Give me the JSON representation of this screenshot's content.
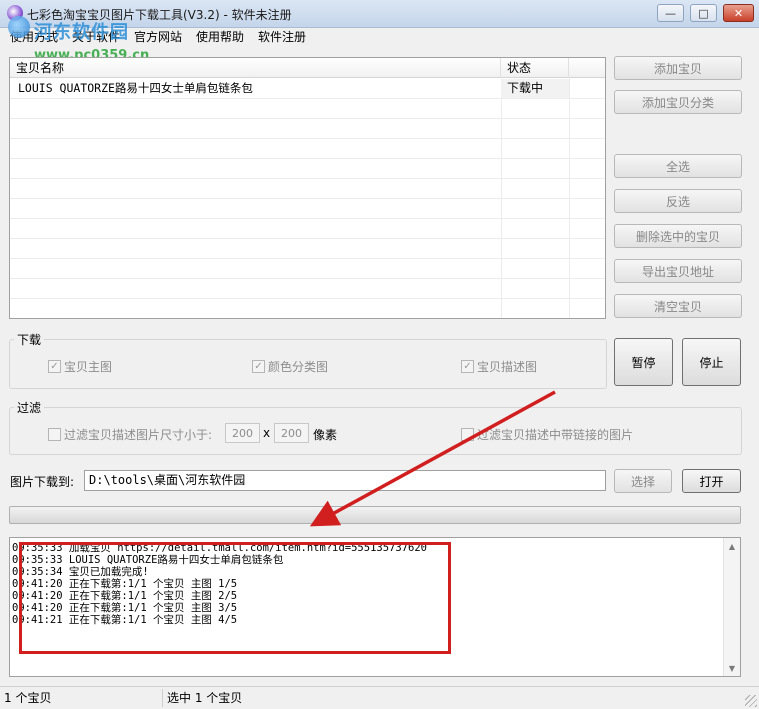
{
  "window": {
    "title": "七彩色淘宝宝贝图片下载工具(V3.2) - 软件未注册",
    "minimize": "—",
    "maximize": "□",
    "close": "✕"
  },
  "menu": [
    "使用方式",
    "关于软件",
    "官方网站",
    "使用帮助",
    "软件注册"
  ],
  "watermark": {
    "name": "河东软件园",
    "url": "www.pc0359.cn"
  },
  "list": {
    "columns": [
      "宝贝名称",
      "状态"
    ],
    "rows": [
      {
        "name": "LOUIS QUATORZE路易十四女士单肩包链条包",
        "status": "下载中"
      }
    ]
  },
  "side_buttons": {
    "add_item": "添加宝贝",
    "add_category": "添加宝贝分类",
    "select_all": "全选",
    "invert": "反选",
    "delete_selected": "删除选中的宝贝",
    "export_addresses": "导出宝贝地址",
    "clear": "清空宝贝"
  },
  "download_group": {
    "label": "下载",
    "main_image": "宝贝主图",
    "color_category": "颜色分类图",
    "description_image": "宝贝描述图"
  },
  "action_buttons": {
    "pause": "暂停",
    "stop": "停止"
  },
  "filter_group": {
    "label": "过滤",
    "size_filter": "过滤宝贝描述图片尺寸小于:",
    "width": "200",
    "times": "x",
    "height": "200",
    "unit": "像素",
    "link_filter": "过滤宝贝描述中带链接的图片"
  },
  "path": {
    "label": "图片下载到:",
    "value": "D:\\tools\\桌面\\河东软件园",
    "choose": "选择",
    "open": "打开"
  },
  "progress": {
    "fraction": 0.0
  },
  "log": [
    "09:35:33 加载宝贝 https://detail.tmall.com/item.htm?id=555135737620",
    "09:35:33 LOUIS QUATORZE路易十四女士单肩包链条包",
    "09:35:34 宝贝已加载完成!",
    "09:41:20 正在下载第:1/1 个宝贝 主图 1/5",
    "09:41:20 正在下载第:1/1 个宝贝 主图 2/5",
    "09:41:20 正在下载第:1/1 个宝贝 主图 3/5",
    "09:41:21 正在下载第:1/1 个宝贝 主图 4/5"
  ],
  "status": {
    "count": "1 个宝贝",
    "selected": "选中 1 个宝贝"
  },
  "colors": {
    "annotation": "#d11f1f",
    "watermark_blue": "#2a8fd9",
    "watermark_green": "#2aa63a"
  }
}
